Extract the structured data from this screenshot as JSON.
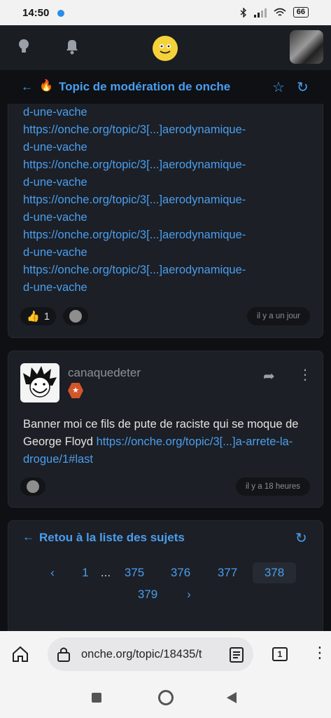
{
  "status": {
    "time": "14:50",
    "battery": "66"
  },
  "topic": {
    "title": "Topic de modération de onche"
  },
  "post1": {
    "first_line": "d-une-vache",
    "link_text": "https://onche.org/topic/3[...]aerodynamique-",
    "link_tail": "d-une-vache",
    "like_count": "1",
    "time": "il y a un jour"
  },
  "post2": {
    "username": "canaquedeter",
    "message_text": "Banner moi ce fils de pute de raciste qui se moque de George Floyd ",
    "message_link": "https://onche.org/topic/3[...]a-arrete-la-drogue/1#last",
    "time": "il y a 18 heures"
  },
  "nav": {
    "back_label": "Retou à la liste des sujets",
    "pages": [
      "1",
      "...",
      "375",
      "376",
      "377",
      "378",
      "379"
    ],
    "current_page": "378",
    "prev": "‹",
    "next": "›"
  },
  "browser": {
    "url": "onche.org/topic/18435/t",
    "tab_count": "1"
  },
  "icons": [
    "lightbulb-icon",
    "bell-icon",
    "smiley-icon",
    "back-arrow-icon",
    "fire-icon",
    "star-icon",
    "refresh-icon",
    "thumbs-up-icon",
    "reaction-face-icon",
    "share-icon",
    "more-vert-icon",
    "home-icon",
    "lock-icon",
    "reader-icon",
    "tabs-icon"
  ],
  "colors": {
    "accent": "#4a9eef",
    "badge": "#d3562a",
    "card": "#1c1f25"
  }
}
